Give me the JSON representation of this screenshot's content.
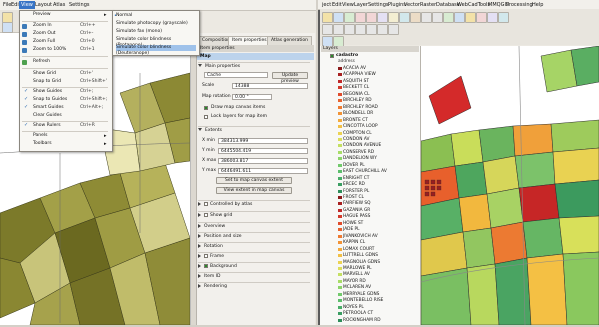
{
  "left_window": {
    "menubar": [
      "File",
      "Edit",
      "View",
      "Layout",
      "Atlas",
      "Settings"
    ],
    "view_menu": {
      "items": [
        {
          "label": "Preview",
          "shortcut": "",
          "has_submenu": true
        },
        {
          "label": "Zoom In",
          "shortcut": "Ctrl++"
        },
        {
          "label": "Zoom Out",
          "shortcut": "Ctrl+-"
        },
        {
          "label": "Zoom Full",
          "shortcut": "Ctrl+0"
        },
        {
          "label": "Zoom to 100%",
          "shortcut": "Ctrl+1"
        },
        {
          "label": "Refresh",
          "shortcut": ""
        },
        {
          "label": "Show Grid",
          "shortcut": "Ctrl+'"
        },
        {
          "label": "Snap to Grid",
          "shortcut": "Ctrl+Shift+'"
        },
        {
          "label": "Show Guides",
          "shortcut": "Ctrl+;"
        },
        {
          "label": "Snap to Guides",
          "shortcut": "Ctrl+Shift+;"
        },
        {
          "label": "Smart Guides",
          "shortcut": "Ctrl+Alt+;"
        },
        {
          "label": "Clear Guides",
          "shortcut": ""
        },
        {
          "label": "Show Rulers",
          "shortcut": "Ctrl+R"
        },
        {
          "label": "Panels",
          "shortcut": ""
        },
        {
          "label": "Toolbars",
          "shortcut": ""
        }
      ]
    },
    "preview_submenu": [
      "Normal",
      "Simulate photocopy (grayscale)",
      "Simulate fax (mono)",
      "Simulate color blindness (Protanope)",
      "Simulate color blindness (Deuteranope)"
    ],
    "panel_tabs": [
      "Composition",
      "Item properties",
      "Atlas generation"
    ],
    "panel_title": "Item properties",
    "item": {
      "header": "Map",
      "main_properties": "Main properties",
      "cache_value": "Cache",
      "update_preview": "Update preview",
      "scale_label": "Scale",
      "scale_value": "14388",
      "rotation_label": "Map rotation",
      "rotation_value": "0.00 °",
      "draw_canvas_items": "Draw map canvas items",
      "lock_layers": "Lock layers for map item",
      "extents": "Extents",
      "xmin_label": "X min",
      "xmin": "384313.999",
      "ymin_label": "Y min",
      "ymin": "6445504.419",
      "xmax_label": "X max",
      "xmax": "386003.817",
      "ymax_label": "Y max",
      "ymax": "6446491.611",
      "set_extent": "Set to map canvas extent",
      "view_extent": "View extent in map canvas",
      "controlled_by_atlas": "Controlled by atlas",
      "show_grid": "Show grid",
      "overview": "Overview",
      "position_size": "Position and size",
      "rotation": "Rotation",
      "frame": "Frame",
      "background": "Background",
      "item_id": "Item ID",
      "rendering": "Rendering"
    }
  },
  "right_window": {
    "menubar": [
      "ject",
      "Edit",
      "View",
      "Layer",
      "Settings",
      "Plugins",
      "Vector",
      "Raster",
      "Database",
      "Web",
      "CadTools",
      "MMQGIS",
      "Processing",
      "Help"
    ],
    "layers_title": "Layers",
    "layer_name": "cadastro",
    "field_name": "address",
    "streets": [
      "ACACIA AV",
      "ACAPPHA VIEW",
      "ASQUITH ST",
      "BECKETT CL",
      "BEGONIA CL",
      "BIRCHLEY RD",
      "BIRCHLEY ROAD",
      "BLONDELL DR",
      "BRONTE CT",
      "CINCOTTA LOOP",
      "COMPTON CL",
      "CONDON AV",
      "CONDON AVENUE",
      "CONSERVE RD",
      "DANDELION WY",
      "DOVER PL",
      "EAST CHURCHILL AV",
      "ENRIGHT CT",
      "ERCEC RD",
      "FORSTER PL",
      "FROST CL",
      "FAIRFIEW SQ",
      "GAZANIA GR",
      "HAGUE PASS",
      "HOWE ST",
      "JADE PL",
      "JIVANKOVICH AV",
      "KAPPIN CL",
      "LOMAX COURT",
      "LUTTRELL GDNS",
      "MAGNOLIA GDNS",
      "MARLOWE PL",
      "MARVELL AV",
      "MAYOR RD",
      "MCLAREN AV",
      "MERRYALE GDNS",
      "MONTEBELLO RISE",
      "NOYES PL",
      "PETROOLA CT",
      "ROCKINGHAM RD"
    ],
    "swatch_colors": [
      "#8b1a1a",
      "#a82020",
      "#c02828",
      "#d23a2a",
      "#e04c2c",
      "#e8632e",
      "#ee7b32",
      "#f29336",
      "#f4aa3c",
      "#f2c046",
      "#ecd252",
      "#dcde5a",
      "#c4e062",
      "#a8dc66",
      "#8cd46a",
      "#72ca6c",
      "#5cbe6c",
      "#4aae68",
      "#3a9e62",
      "#2e8e5a"
    ]
  }
}
